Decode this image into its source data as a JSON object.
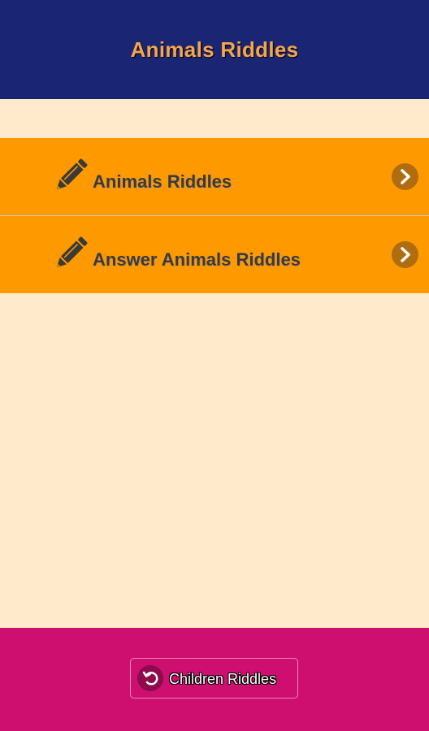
{
  "header": {
    "title": "Animals Riddles"
  },
  "menu": {
    "items": [
      {
        "label": "Animals Riddles",
        "icon": "pencil-icon",
        "arrow": "chevron-right-icon"
      },
      {
        "label": "Answer Animals Riddles",
        "icon": "pencil-icon",
        "arrow": "chevron-right-icon"
      }
    ]
  },
  "footer": {
    "back_label": "Children Riddles",
    "back_icon": "undo-icon"
  },
  "colors": {
    "header_bg": "#1a2673",
    "title": "#f6a54e",
    "content_bg": "#ffeacc",
    "menu_bg": "#ff9900",
    "chevron_bg": "#b06d10",
    "footer_bg": "#cf0f6f"
  }
}
